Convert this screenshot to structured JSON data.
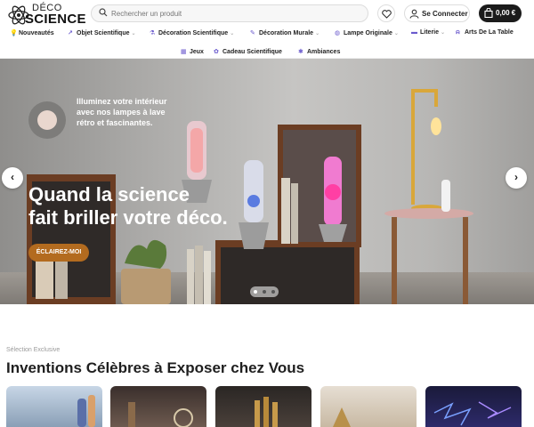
{
  "header": {
    "logo_top": "DÉCO",
    "logo_bottom": "SCIENCE",
    "search_placeholder": "Rechercher un produit",
    "login_label": "Se Connecter",
    "cart_total": "0,00 €"
  },
  "nav": {
    "items": [
      {
        "label": "Nouveautés",
        "icon": "lamp-icon",
        "caret": false
      },
      {
        "label": "Objet Scientifique",
        "icon": "telescope-icon",
        "caret": true
      },
      {
        "label": "Décoration Scientifique",
        "icon": "flask-icon",
        "caret": true
      },
      {
        "label": "Décoration Murale",
        "icon": "wall-art-icon",
        "caret": true
      },
      {
        "label": "Lampe Originale",
        "icon": "lava-lamp-icon",
        "caret": true
      },
      {
        "label": "Literie",
        "icon": "bed-icon",
        "caret": true
      },
      {
        "label": "Arts De La Table",
        "icon": "tableware-icon",
        "caret": true
      },
      {
        "label": "Jeux",
        "icon": "game-icon",
        "caret": false
      },
      {
        "label": "Cadeau Scientifique",
        "icon": "gift-icon",
        "caret": false
      },
      {
        "label": "Ambiances",
        "icon": "sparkle-icon",
        "caret": false
      }
    ]
  },
  "hero": {
    "small_text": "Illuminez votre intérieur avec nos lampes à lave rétro et fascinantes.",
    "title_line1": "Quand la science",
    "title_line2": "fait briller votre déco.",
    "cta": "ÉCLAIREZ-MOI",
    "prev_symbol": "‹",
    "next_symbol": "›",
    "slides_count": 3,
    "active_slide": 1
  },
  "section": {
    "kicker": "Sélection Exclusive",
    "title": "Inventions Célèbres à Exposer chez Vous"
  },
  "colors": {
    "cta": "#b36b1f",
    "cart_bg": "#1b1b1b",
    "nav_accent": "#6a5acd"
  }
}
